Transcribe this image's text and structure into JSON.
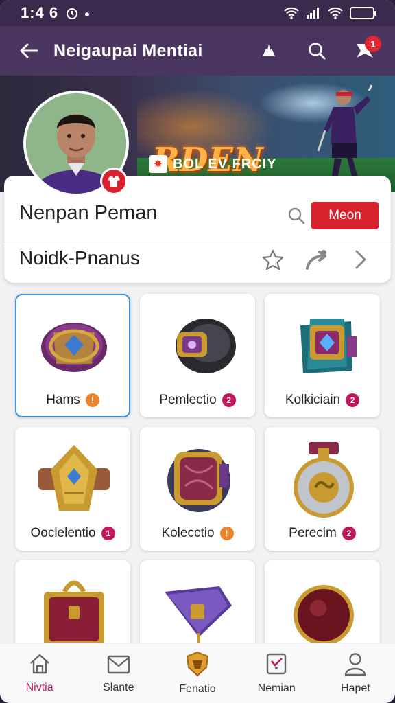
{
  "status_bar": {
    "time": "1:4 6",
    "battery_level": 0.8
  },
  "app_bar": {
    "title": "Neigaupai Mentiai",
    "notification_count": "1"
  },
  "banner": {
    "title": "RDEN",
    "subtitle": "BOL EV FRCIY"
  },
  "profile": {
    "name": "Nenpan Peman",
    "menu_label": "Meon",
    "section_title": "Noidk-Pnanus"
  },
  "items": [
    {
      "label": "Hams",
      "badge": "!",
      "badge_color": "#e8842a",
      "art": "bracer-purple"
    },
    {
      "label": "Pemlectio",
      "badge": "2",
      "badge_color": "#c2185b",
      "art": "bracer-black"
    },
    {
      "label": "Kolkiciain",
      "badge": "2",
      "badge_color": "#c2185b",
      "art": "bracer-teal"
    },
    {
      "label": "Ooclelentio",
      "badge": "1",
      "badge_color": "#c2185b",
      "art": "bracer-gold"
    },
    {
      "label": "Kolecctio",
      "badge": "!",
      "badge_color": "#e8842a",
      "art": "bracer-crimson"
    },
    {
      "label": "Perecim",
      "badge": "2",
      "badge_color": "#c2185b",
      "art": "orb-silver"
    },
    {
      "label": "",
      "badge": "",
      "badge_color": "",
      "art": "chest-red"
    },
    {
      "label": "",
      "badge": "",
      "badge_color": "",
      "art": "pennant-purple"
    },
    {
      "label": "",
      "badge": "",
      "badge_color": "",
      "art": "orb-red"
    }
  ],
  "bottom_nav": [
    {
      "label": "Nivtia",
      "icon": "home-icon",
      "active": true
    },
    {
      "label": "Slante",
      "icon": "mail-icon",
      "active": false
    },
    {
      "label": "Fenatio",
      "icon": "shield-icon",
      "active": false
    },
    {
      "label": "Nemian",
      "icon": "card-icon",
      "active": false
    },
    {
      "label": "Hapet",
      "icon": "person-icon",
      "active": false
    }
  ],
  "colors": {
    "accent": "#d8232f",
    "appbar": "#4a3660",
    "statusbar": "#3b2a4d",
    "selected": "#3b95d8"
  }
}
